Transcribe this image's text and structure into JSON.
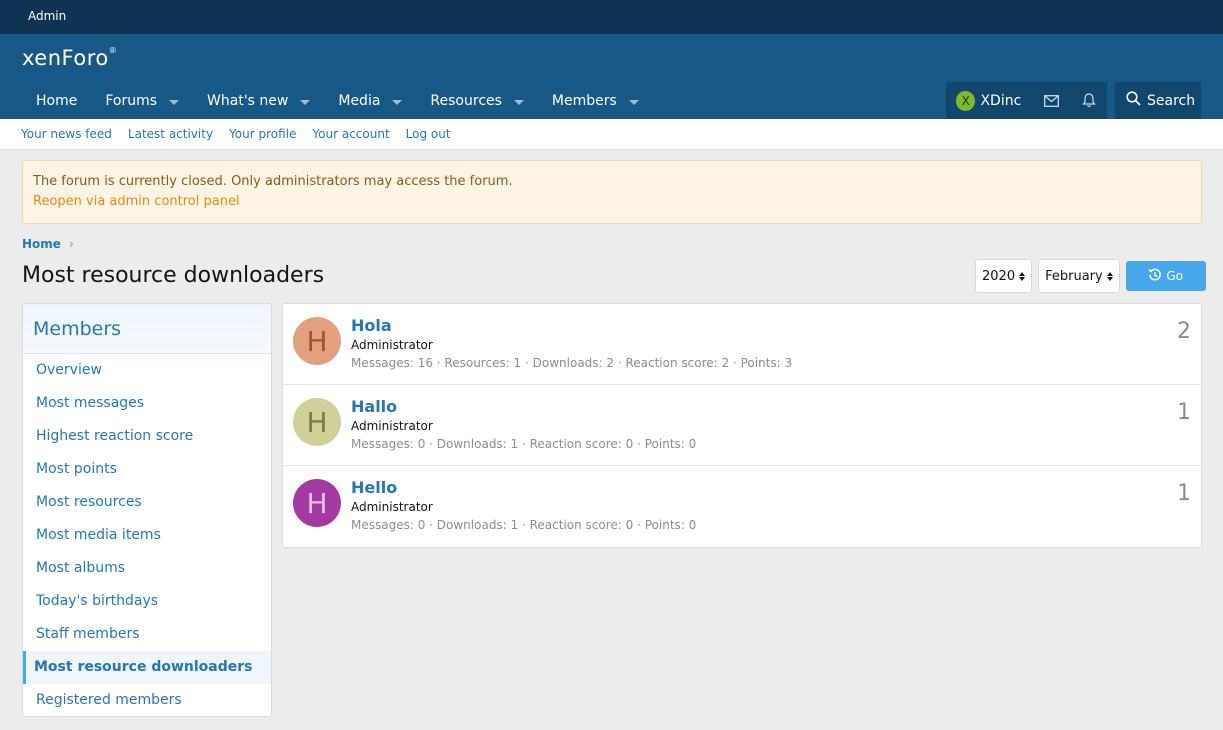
{
  "admin_bar": {
    "label": "Admin"
  },
  "logo": {
    "text": "xenForo",
    "reg": "®"
  },
  "nav": [
    {
      "label": "Home",
      "dropdown": false
    },
    {
      "label": "Forums",
      "dropdown": true
    },
    {
      "label": "What's new",
      "dropdown": true
    },
    {
      "label": "Media",
      "dropdown": true
    },
    {
      "label": "Resources",
      "dropdown": true
    },
    {
      "label": "Members",
      "dropdown": true
    }
  ],
  "user": {
    "initial": "X",
    "name": "XDinc",
    "avatar_color": "#7fba2a"
  },
  "search": {
    "label": "Search"
  },
  "subnav": [
    "Your news feed",
    "Latest activity",
    "Your profile",
    "Your account",
    "Log out"
  ],
  "notice": {
    "message": "The forum is currently closed. Only administrators may access the forum.",
    "link": "Reopen via admin control panel"
  },
  "breadcrumb": {
    "home": "Home",
    "sep": "›"
  },
  "page": {
    "title": "Most resource downloaders"
  },
  "filters": {
    "year": "2020",
    "month": "February",
    "go_label": "Go"
  },
  "sidebar": {
    "title": "Members",
    "items": [
      "Overview",
      "Most messages",
      "Highest reaction score",
      "Most points",
      "Most resources",
      "Most media items",
      "Most albums",
      "Today's birthdays",
      "Staff members",
      "Most resource downloaders",
      "Registered members"
    ],
    "active_index": 9
  },
  "members": [
    {
      "initial": "H",
      "name": "Hola",
      "role": "Administrator",
      "stats": "Messages: 16 · Resources: 1 · Downloads: 2 · Reaction score: 2 · Points: 3",
      "count": "2",
      "bg": "#e3a07e",
      "fg": "#a4532b"
    },
    {
      "initial": "H",
      "name": "Hallo",
      "role": "Administrator",
      "stats": "Messages: 0 · Downloads: 1 · Reaction score: 0 · Points: 0",
      "count": "1",
      "bg": "#cfd09a",
      "fg": "#7d7c3c"
    },
    {
      "initial": "H",
      "name": "Hello",
      "role": "Administrator",
      "stats": "Messages: 0 · Downloads: 1 · Reaction score: 0 · Points: 0",
      "count": "1",
      "bg": "#a23aa1",
      "fg": "#ecbfeb"
    }
  ]
}
